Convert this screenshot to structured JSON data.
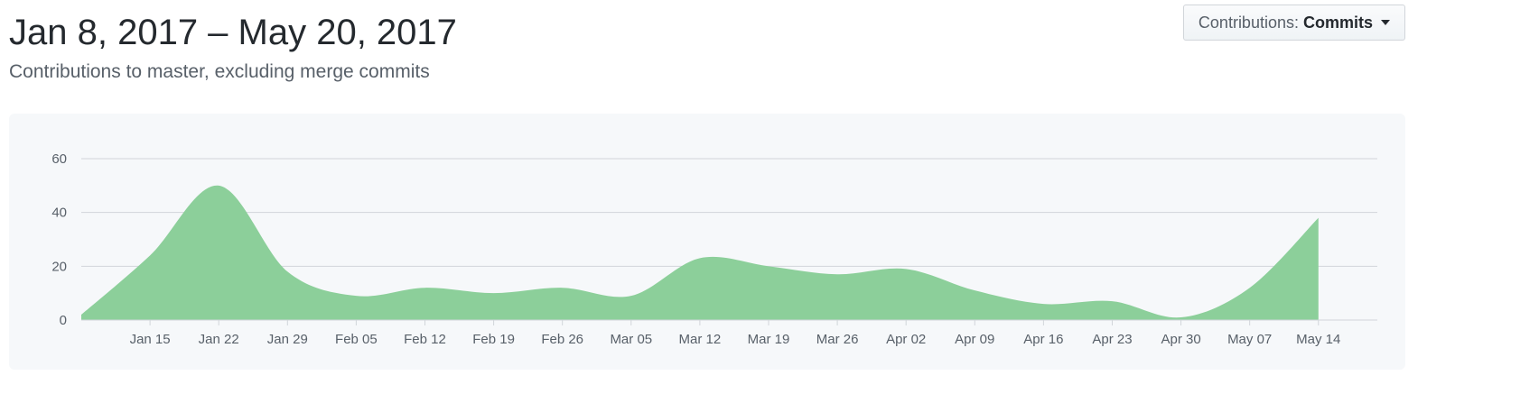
{
  "header": {
    "title": "Jan 8, 2017 – May 20, 2017",
    "subtitle": "Contributions to master, excluding merge commits"
  },
  "dropdown": {
    "label": "Contributions:",
    "value": "Commits",
    "icon": "caret-down-icon"
  },
  "colors": {
    "area_fill": "#8ccf9a",
    "grid": "#d1d5da",
    "panel": "#f6f8fa"
  },
  "chart_data": {
    "type": "area",
    "x_axis": {
      "unit": "date",
      "start": "2017-01-08",
      "end": "2017-05-20",
      "tick_dates": [
        "2017-01-15",
        "2017-01-22",
        "2017-01-29",
        "2017-02-05",
        "2017-02-12",
        "2017-02-19",
        "2017-02-26",
        "2017-03-05",
        "2017-03-12",
        "2017-03-19",
        "2017-03-26",
        "2017-04-02",
        "2017-04-09",
        "2017-04-16",
        "2017-04-23",
        "2017-04-30",
        "2017-05-07",
        "2017-05-14"
      ],
      "tick_labels": [
        "Jan 15",
        "Jan 22",
        "Jan 29",
        "Feb 05",
        "Feb 12",
        "Feb 19",
        "Feb 26",
        "Mar 05",
        "Mar 12",
        "Mar 19",
        "Mar 26",
        "Apr 02",
        "Apr 09",
        "Apr 16",
        "Apr 23",
        "Apr 30",
        "May 07",
        "May 14"
      ]
    },
    "y_axis": {
      "ylim": [
        0,
        60
      ],
      "ticks": [
        0,
        20,
        40,
        60
      ],
      "tick_labels": [
        "0",
        "20",
        "40",
        "60"
      ]
    },
    "grid": true,
    "legend": "none",
    "series": [
      {
        "x": [
          "2017-01-08",
          "2017-01-15",
          "2017-01-22",
          "2017-01-29",
          "2017-02-05",
          "2017-02-12",
          "2017-02-19",
          "2017-02-26",
          "2017-03-05",
          "2017-03-12",
          "2017-03-19",
          "2017-03-26",
          "2017-04-02",
          "2017-04-09",
          "2017-04-16",
          "2017-04-23",
          "2017-04-30",
          "2017-05-07",
          "2017-05-14"
        ],
        "values": [
          2,
          24,
          50,
          18,
          9,
          12,
          10,
          12,
          9,
          23,
          20,
          17,
          19,
          11,
          6,
          7,
          1,
          12,
          38
        ]
      }
    ]
  }
}
